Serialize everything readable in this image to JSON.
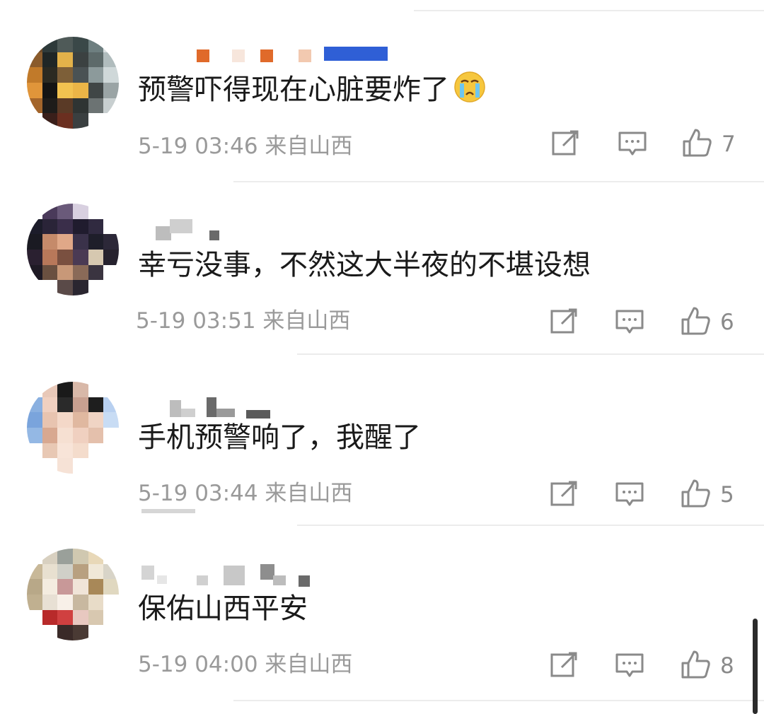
{
  "comments": [
    {
      "text": "预警吓得现在心脏要炸了",
      "emoji": "crying-face-icon",
      "meta": "5-19 03:46 来自山西",
      "likes": "7"
    },
    {
      "text": "幸亏没事，不然这大半夜的不堪设想",
      "meta": "5-19 03:51 来自山西",
      "likes": "6"
    },
    {
      "text": "手机预警响了，我醒了",
      "meta": "5-19 03:44 来自山西",
      "likes": "5"
    },
    {
      "text": "保佑山西平安",
      "meta": "5-19 04:00 来自山西",
      "likes": "8"
    }
  ],
  "icons": {
    "repost": "repost-icon",
    "comment": "comment-icon",
    "like": "thumbs-up-icon"
  },
  "colors": {
    "text": "#1a1a1a",
    "meta": "#9a9a9a",
    "icon": "#8a8a8a",
    "divider": "#ececec"
  }
}
